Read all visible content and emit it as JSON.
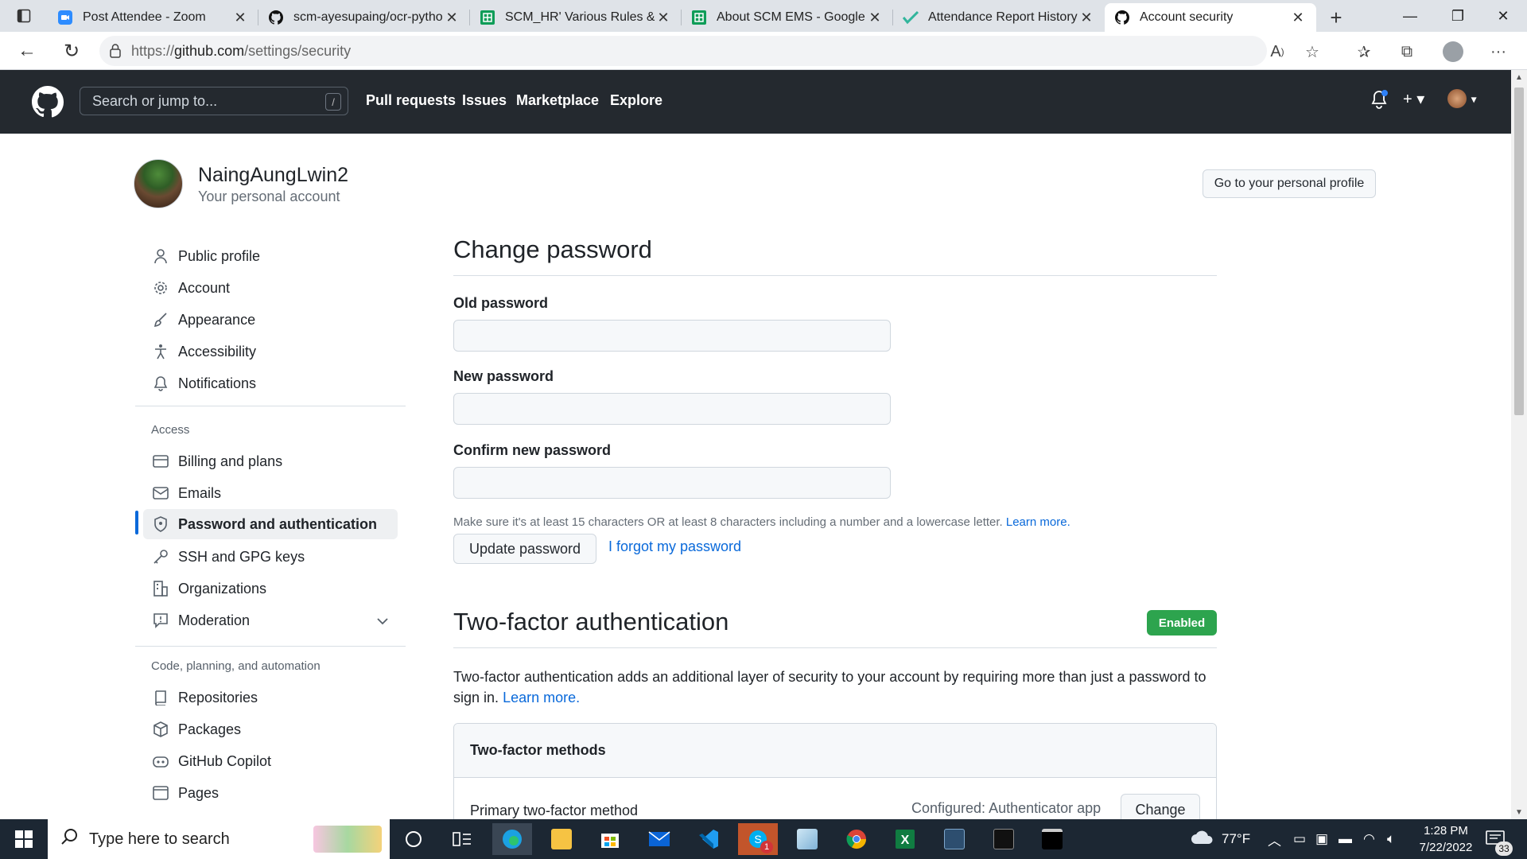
{
  "browser": {
    "tabs": [
      {
        "title": "Post Attendee - Zoom",
        "favicon": "zoom-icon"
      },
      {
        "title": "scm-ayesupaing/ocr-pytho",
        "favicon": "github-icon"
      },
      {
        "title": "SCM_HR' Various Rules & Fl",
        "favicon": "sheets-icon"
      },
      {
        "title": "About SCM EMS - Google S",
        "favicon": "sheets-icon"
      },
      {
        "title": "Attendance Report History",
        "favicon": "check-icon"
      },
      {
        "title": "Account security",
        "favicon": "github-icon"
      }
    ],
    "url_prefix": "https://",
    "url_host": "github.com",
    "url_path": "/settings/security"
  },
  "header": {
    "search_placeholder": "Search or jump to...",
    "search_key": "/",
    "nav": [
      "Pull requests",
      "Issues",
      "Marketplace",
      "Explore"
    ]
  },
  "account": {
    "username": "NaingAungLwin2",
    "subtitle": "Your personal account",
    "profile_button": "Go to your personal profile"
  },
  "sidebar": {
    "items": [
      {
        "label": "Public profile",
        "icon": "person-icon"
      },
      {
        "label": "Account",
        "icon": "gear-icon"
      },
      {
        "label": "Appearance",
        "icon": "paintbrush-icon"
      },
      {
        "label": "Accessibility",
        "icon": "accessibility-icon"
      },
      {
        "label": "Notifications",
        "icon": "bell-icon"
      }
    ],
    "access_heading": "Access",
    "access_items": [
      {
        "label": "Billing and plans",
        "icon": "credit-card-icon"
      },
      {
        "label": "Emails",
        "icon": "mail-icon"
      },
      {
        "label": "Password and authentication",
        "icon": "shield-lock-icon"
      },
      {
        "label": "SSH and GPG keys",
        "icon": "key-icon"
      },
      {
        "label": "Organizations",
        "icon": "organization-icon"
      },
      {
        "label": "Moderation",
        "icon": "report-icon"
      }
    ],
    "code_heading": "Code, planning, and automation",
    "code_items": [
      {
        "label": "Repositories",
        "icon": "repo-icon"
      },
      {
        "label": "Packages",
        "icon": "package-icon"
      },
      {
        "label": "GitHub Copilot",
        "icon": "copilot-icon"
      },
      {
        "label": "Pages",
        "icon": "browser-icon"
      }
    ]
  },
  "change_password": {
    "title": "Change password",
    "old_label": "Old password",
    "new_label": "New password",
    "confirm_label": "Confirm new password",
    "hint": "Make sure it's at least 15 characters OR at least 8 characters including a number and a lowercase letter.",
    "hint_link": "Learn more.",
    "update_button": "Update password",
    "forgot_link": "I forgot my password"
  },
  "two_factor": {
    "title": "Two-factor authentication",
    "status": "Enabled",
    "description": "Two-factor authentication adds an additional layer of security to your account by requiring more than just a password to sign in.",
    "learn_more": "Learn more.",
    "methods_title": "Two-factor methods",
    "primary_label": "Primary two-factor method",
    "primary_value": "Configured: Authenticator app",
    "change_button": "Change"
  },
  "taskbar": {
    "search_placeholder": "Type here to search",
    "weather": "77°F",
    "time": "1:28 PM",
    "date": "7/22/2022",
    "notification_count": "33",
    "skype_badge": "1"
  },
  "colors": {
    "header_bg": "#24292f",
    "link": "#0969da",
    "enabled_badge": "#2da44e",
    "selected_marker": "#0969da"
  }
}
